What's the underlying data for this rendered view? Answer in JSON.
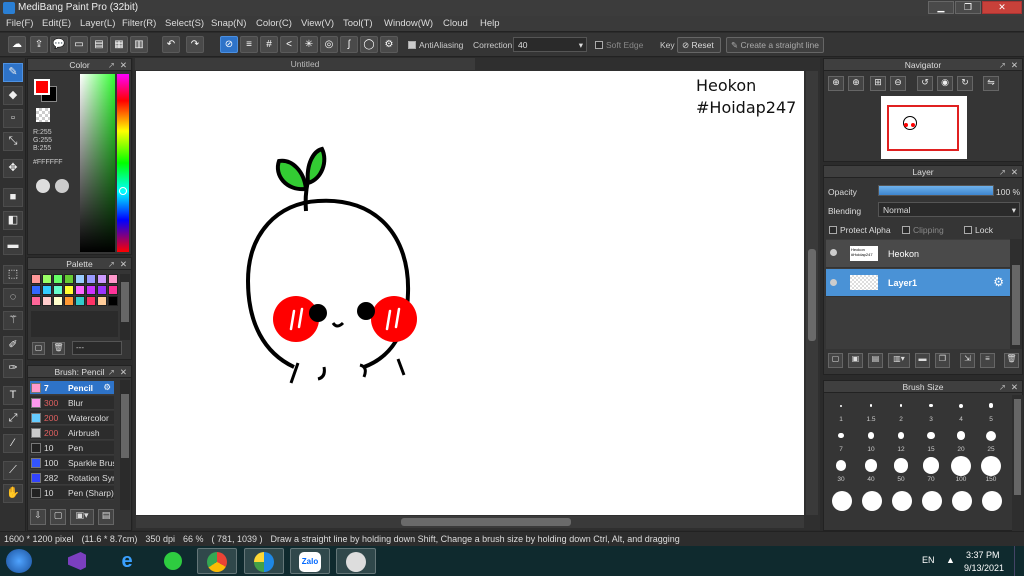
{
  "window": {
    "title": "MediBang Paint Pro (32bit)",
    "min": "▁",
    "max": "❐",
    "close": "✕"
  },
  "menu": [
    "File(F)",
    "Edit(E)",
    "Layer(L)",
    "Filter(R)",
    "Select(S)",
    "Snap(N)",
    "Color(C)",
    "View(V)",
    "Tool(T)",
    "Window(W)",
    "Cloud",
    "Help"
  ],
  "toolbar": {
    "antialiasing_label": "AntiAliasing",
    "correction_label": "Correction",
    "correction_value": "40",
    "soft_edge_label": "Soft Edge",
    "key_label": "Key",
    "reset_label": "Reset",
    "straight_line_label": "Create a straight line"
  },
  "color_panel": {
    "title": "Color",
    "rgb": [
      "R:255",
      "G:255",
      "B:255"
    ],
    "hex": "#FFFFFF",
    "primary": "#ff0000",
    "secondary": "#000000"
  },
  "palette_panel": {
    "title": "Palette",
    "swatches": [
      "#ff9999",
      "#99ff66",
      "#66ff66",
      "#66cc33",
      "#99ccff",
      "#9999ff",
      "#cc99ff",
      "#ff99cc",
      "#3366ff",
      "#33ccff",
      "#66ffcc",
      "#ffff33",
      "#ff66ff",
      "#cc33ff",
      "#9933ff",
      "#ff3399",
      "#ff6699",
      "#ffcccc",
      "#ffffcc",
      "#ff9933",
      "#33cccc",
      "#ff3366",
      "#ffcc99",
      "#000000"
    ],
    "footer_label": "---"
  },
  "brush_panel": {
    "title": "Brush: Pencil",
    "items": [
      {
        "size": "7",
        "name": "Pencil",
        "color": "#ff99cc"
      },
      {
        "size": "300",
        "name": "Blur",
        "color": "#ff99ee"
      },
      {
        "size": "200",
        "name": "Watercolor",
        "color": "#66ccff"
      },
      {
        "size": "200",
        "name": "Airbrush",
        "color": "#cccccc"
      },
      {
        "size": "10",
        "name": "Pen",
        "color": "#222222"
      },
      {
        "size": "100",
        "name": "Sparkle Brush",
        "color": "#3355ff"
      },
      {
        "size": "282",
        "name": "Rotation Symmetry",
        "color": "#3344ff"
      },
      {
        "size": "10",
        "name": "Pen (Sharp)",
        "color": "#222222"
      }
    ]
  },
  "document": {
    "tab": "Untitled",
    "overlay_text": [
      "Heokon",
      "#Hoidap247"
    ]
  },
  "navigator": {
    "title": "Navigator"
  },
  "layer_panel": {
    "title": "Layer",
    "opacity_label": "Opacity",
    "opacity_value": "100 %",
    "opacity_fraction": 1.0,
    "blending_label": "Blending",
    "blending_value": "Normal",
    "protect_alpha": "Protect Alpha",
    "clipping": "Clipping",
    "lock": "Lock",
    "layers": [
      {
        "name": "Heokon",
        "selected": false
      },
      {
        "name": "Layer1",
        "selected": true
      }
    ]
  },
  "brush_size_panel": {
    "title": "Brush Size",
    "sizes": [
      "1",
      "1.5",
      "2",
      "3",
      "4",
      "5",
      "7",
      "10",
      "12",
      "15",
      "20",
      "25",
      "30",
      "40",
      "50",
      "70",
      "100",
      "150"
    ]
  },
  "status": {
    "dimensions": "1600 * 1200 pixel",
    "cm": "(11.6 * 8.7cm)",
    "dpi": "350 dpi",
    "zoom": "66 %",
    "coords": "( 781, 1039 )",
    "hint": "Draw a straight line by holding down Shift, Change a brush size by holding down Ctrl, Alt, and dragging"
  },
  "taskbar": {
    "lang": "EN",
    "time": "3:37 PM",
    "date": "9/13/2021",
    "zalo_label": "Zalo"
  }
}
